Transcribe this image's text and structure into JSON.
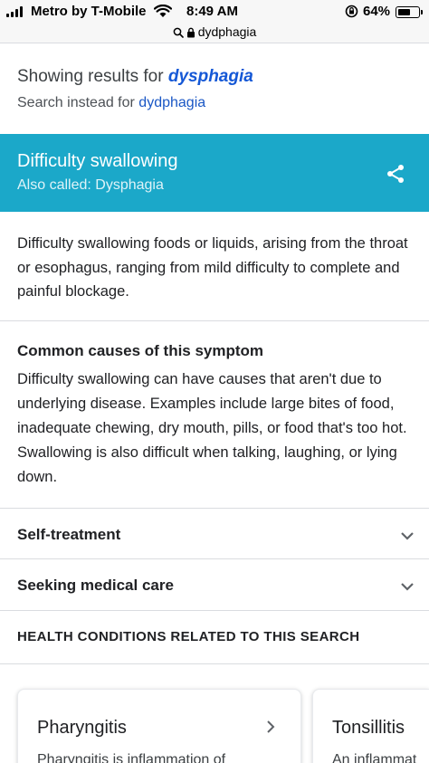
{
  "status_bar": {
    "carrier": "Metro by T-Mobile",
    "time": "8:49 AM",
    "battery": "64%",
    "battery_level": 0.64
  },
  "url_bar": {
    "url": "dydphagia"
  },
  "spelling": {
    "showing_prefix": "Showing results for ",
    "corrected_term": "dysphagia",
    "search_instead_prefix": "Search instead for ",
    "original_term": "dydphagia"
  },
  "knowledge_panel": {
    "title": "Difficulty swallowing",
    "also_called": "Also called: Dysphagia",
    "header_color": "#1ba8c9",
    "description": "Difficulty swallowing foods or liquids, arising from the throat or esophagus, ranging from mild difficulty to complete and painful blockage.",
    "causes_title": "Common causes of this symptom",
    "causes_body": "Difficulty swallowing can have causes that aren't due to underlying disease. Examples include large bites of food, inadequate chewing, dry mouth, pills, or food that's too hot. Swallowing is also difficult when talking, laughing, or lying down.",
    "sections": [
      {
        "label": "Self-treatment"
      },
      {
        "label": "Seeking medical care"
      }
    ]
  },
  "related": {
    "heading": "HEALTH CONDITIONS RELATED TO THIS SEARCH",
    "cards": [
      {
        "title": "Pharyngitis",
        "description": "Pharyngitis is inflammation of"
      },
      {
        "title": "Tonsillitis",
        "description": "An inflammat"
      }
    ]
  }
}
